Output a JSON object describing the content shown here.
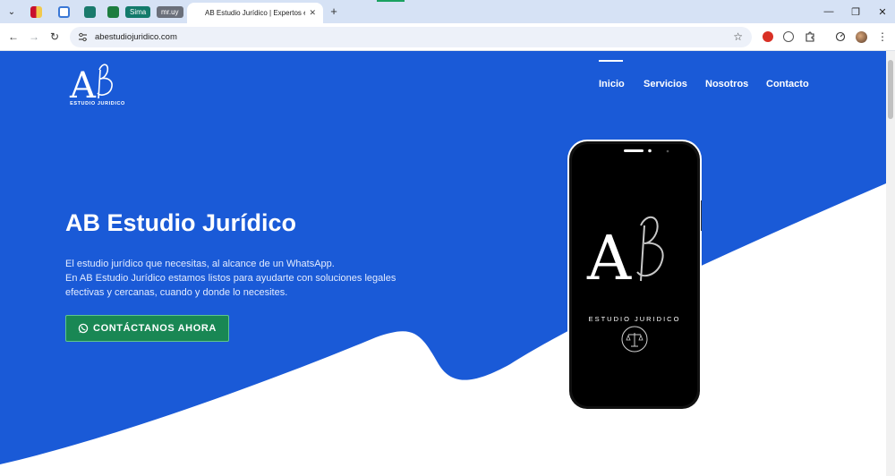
{
  "browser": {
    "active_tab_title": "AB Estudio Jurídico | Expertos en",
    "pinned_labels": [
      "Sima",
      "mr.uy"
    ],
    "url": "abestudiojuridico.com"
  },
  "site": {
    "logo_letters": "AB",
    "logo_subtitle": "ESTUDIO JURIDICO",
    "nav": [
      "Inicio",
      "Servicios",
      "Nosotros",
      "Contacto"
    ],
    "hero": {
      "title": "AB Estudio Jurídico",
      "lines": [
        "El estudio jurídico que necesitas, al alcance de un WhatsApp.",
        "En AB Estudio Jurídico estamos listos para ayudarte con soluciones legales",
        "efectivas y cercanas, cuando y donde lo necesites."
      ],
      "cta": "CONTÁCTANOS AHORA"
    },
    "phone_screen": {
      "letters": "AB",
      "brand": "ESTUDIO JURIDICO"
    }
  },
  "colors": {
    "hero_blue": "#1a5ad7",
    "cta_green": "#198754",
    "chrome_tabstrip": "#d6e2f5"
  }
}
